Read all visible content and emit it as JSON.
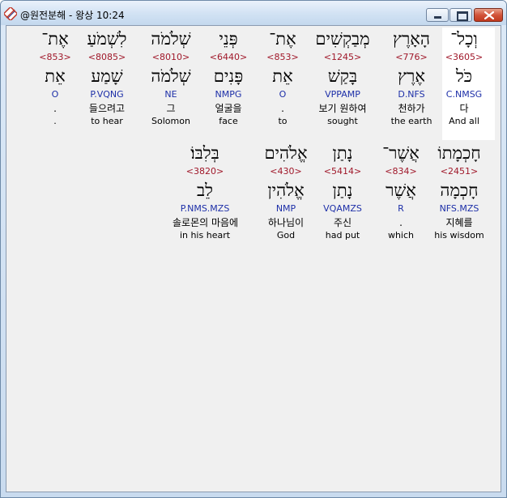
{
  "window": {
    "title": "@원전분해 - 왕상 10:24"
  },
  "icons": {
    "app": "bible-app-icon",
    "minimize": "minimize-icon",
    "maximize": "maximize-icon",
    "close": "close-icon"
  },
  "colors": {
    "strong": "#a0182a",
    "parse": "#1d2fa8",
    "highlight": "#ffffff"
  },
  "rows": [
    {
      "words": [
        {
          "hebrew": "וְכָל־",
          "strong": "<3605>",
          "lemma": "כֹּל",
          "parse": "C.NMSG",
          "korean": "다",
          "english": "And all",
          "selected": true
        },
        {
          "hebrew": "הָאָרֶץ",
          "strong": "<776>",
          "lemma": "אֶרֶץ",
          "parse": "D.NFS",
          "korean": "천하가",
          "english": "the earth"
        },
        {
          "hebrew": "מְבַקְשִׁים",
          "strong": "<1245>",
          "lemma": "בָּקַשׁ",
          "parse": "VPPAMP",
          "korean": "보기 원하여",
          "english": "sought"
        },
        {
          "hebrew": "אֶת־",
          "strong": "<853>",
          "lemma": "אֵת",
          "parse": "O",
          "korean": ".",
          "english": "to"
        },
        {
          "hebrew": "פְּנֵי",
          "strong": "<6440>",
          "lemma": "פָּנִים",
          "parse": "NMPG",
          "korean": "얼굴을",
          "english": "face"
        },
        {
          "hebrew": "שְׁלֹמֹה",
          "strong": "<8010>",
          "lemma": "שְׁלֹמֹה",
          "parse": "NE",
          "korean": "그",
          "english": "Solomon"
        },
        {
          "hebrew": "לִשְׁמֹעַ",
          "strong": "<8085>",
          "lemma": "שָׁמַע",
          "parse": "P.VQNG",
          "korean": "들으려고",
          "english": "to hear"
        },
        {
          "hebrew": "אֶת־",
          "strong": "<853>",
          "lemma": "אֵת",
          "parse": "O",
          "korean": ".",
          "english": "."
        }
      ]
    },
    {
      "words": [
        {
          "hebrew": "חָכְמָתוֹ",
          "strong": "<2451>",
          "lemma": "חָכְמָה",
          "parse": "NFS.MZS",
          "korean": "지혜를",
          "english": "his wisdom"
        },
        {
          "hebrew": "אֲשֶׁר־",
          "strong": "<834>",
          "lemma": "אֲשֶׁר",
          "parse": "R",
          "korean": ".",
          "english": "which"
        },
        {
          "hebrew": "נָתַן",
          "strong": "<5414>",
          "lemma": "נָתַן",
          "parse": "VQAMZS",
          "korean": "주신",
          "english": "had put"
        },
        {
          "hebrew": "אֱלֹהִים",
          "strong": "<430>",
          "lemma": "אֱלֹהִין",
          "parse": "NMP",
          "korean": "하나님이",
          "english": "God"
        },
        {
          "hebrew": "בְּלִבּוֹ׃",
          "strong": "<3820>",
          "lemma": "לֵב",
          "parse": "P.NMS.MZS",
          "korean": "솔로몬의 마음에",
          "english": "in his heart"
        }
      ]
    }
  ]
}
